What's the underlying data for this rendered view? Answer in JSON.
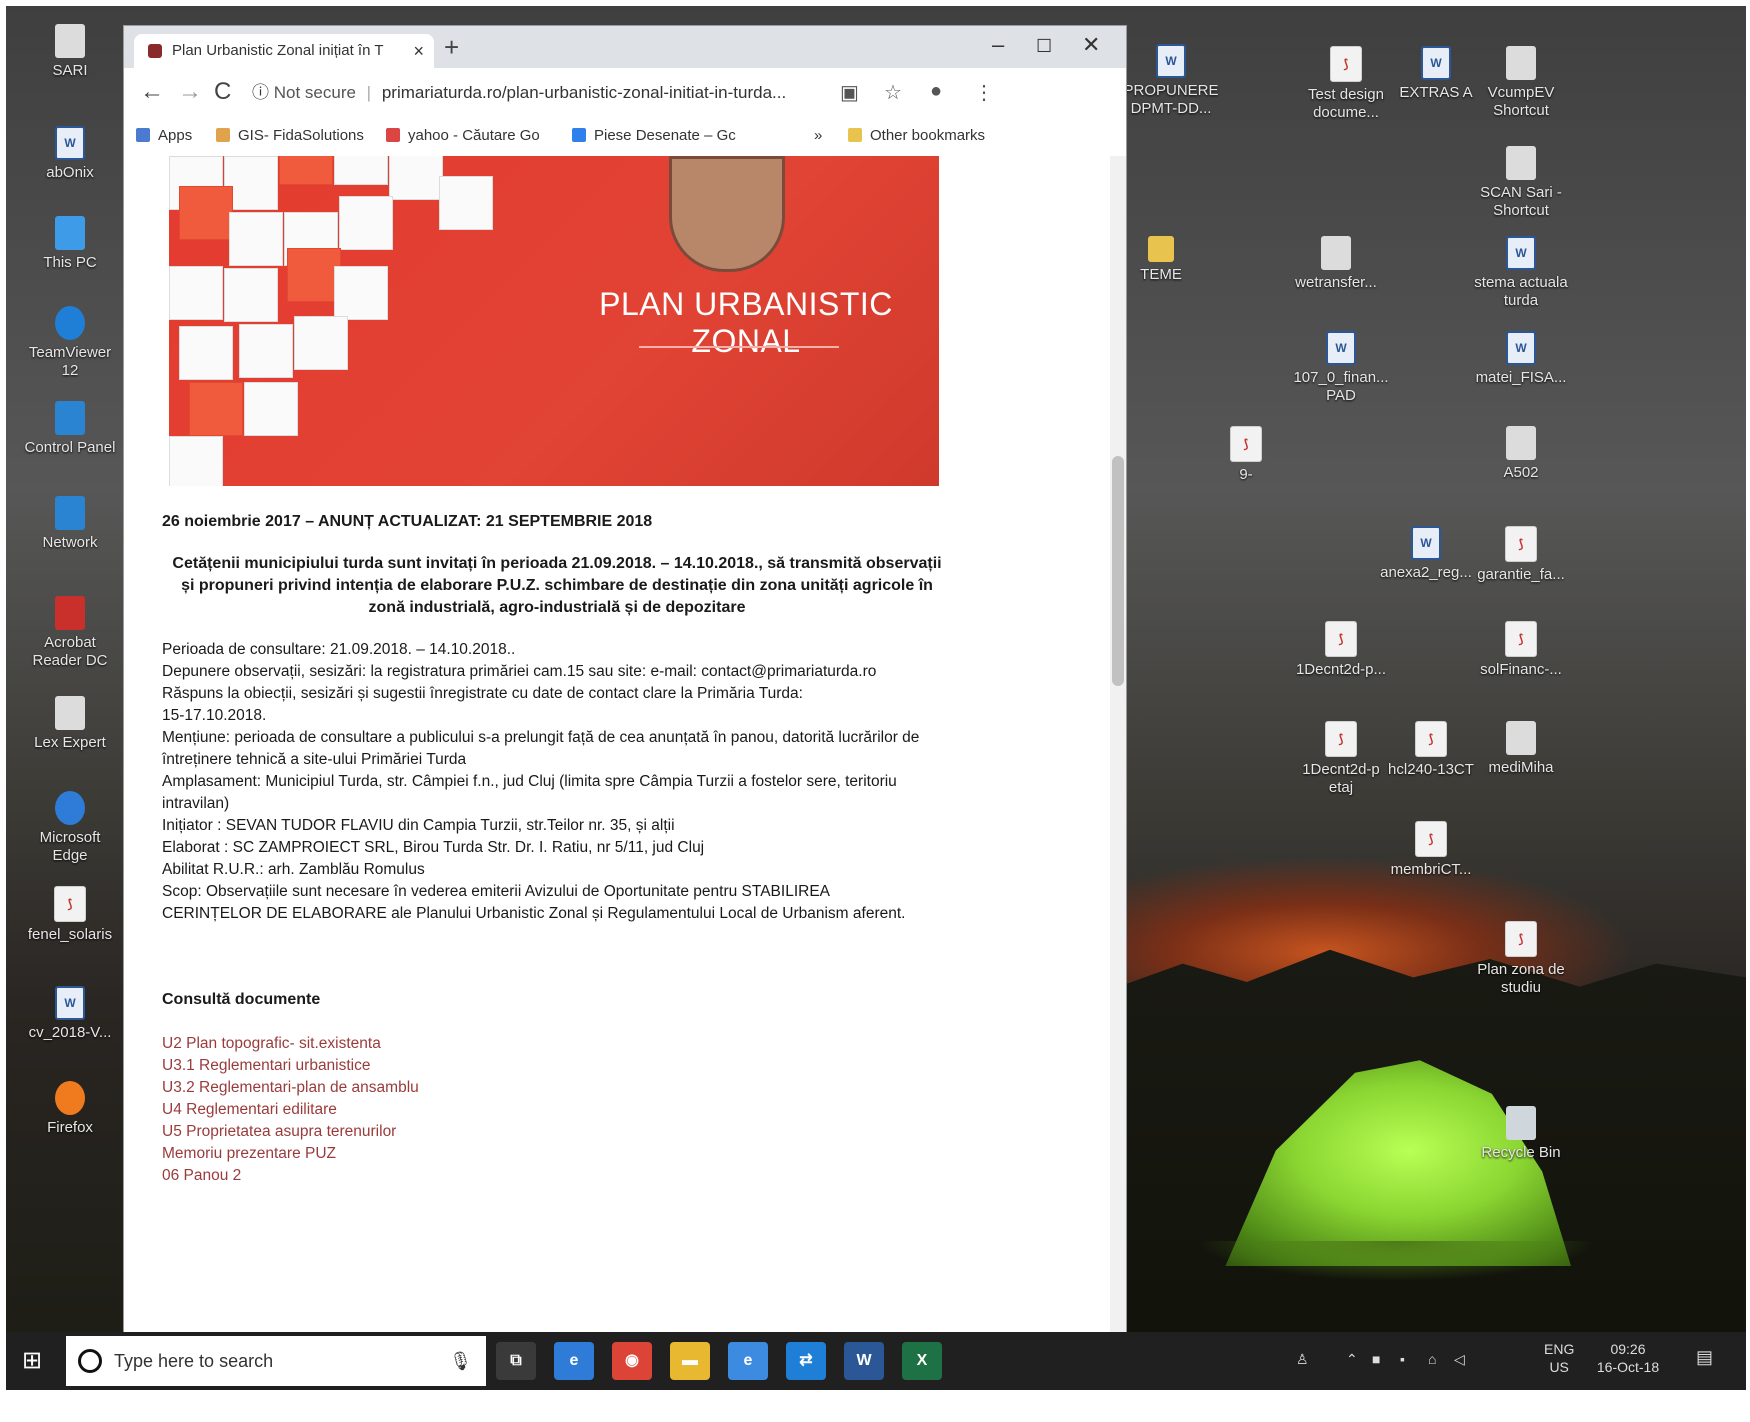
{
  "browser": {
    "tab_title": "Plan Urbanistic Zonal inițiat în T",
    "tab_close": "×",
    "new_tab": "+",
    "window_controls": {
      "minimize": "–",
      "maximize": "☐",
      "close": "✕"
    },
    "nav": {
      "back": "←",
      "forward": "→",
      "reload": "C"
    },
    "security_label": "Not secure",
    "url": "primariaturda.ro/plan-urbanistic-zonal-initiat-in-turda...",
    "bookmarks": [
      {
        "label": "Apps",
        "icon": "apps-grid-icon"
      },
      {
        "label": "GIS- FidaSolutions",
        "icon": "gis-icon"
      },
      {
        "label": "yahoo - Căutare Go",
        "icon": "google-icon"
      },
      {
        "label": "Piese Desenate – Gc",
        "icon": "drive-icon"
      }
    ],
    "bookmarks_more": "»",
    "other_bookmarks": "Other bookmarks"
  },
  "page": {
    "banner_title": "PLAN URBANISTIC ZONAL",
    "heading": "26 noiembrie 2017 – ANUNȚ ACTUALIZAT: 21 SEPTEMBRIE 2018",
    "intro_lines": [
      "Cetățenii municipiului turda sunt invitați în perioada 21.09.2018. – 14.10.2018., să transmită observații",
      "și propuneri privind intenția de elaborare P.U.Z. schimbare de destinație din zona unități agricole în",
      "zonă industrială, agro-industrială și de depozitare"
    ],
    "details": [
      "Perioada de consultare: 21.09.2018. – 14.10.2018..",
      "Depunere observații, sesizări: la registratura primăriei cam.15 sau site: e-mail: contact@primariaturda.ro",
      "Răspuns la obiecții, sesizări și sugestii înregistrate cu date de contact clare la Primăria Turda:",
      "15-17.10.2018.",
      "Mențiune: perioada de consultare a publicului s-a prelungit față de cea anunțată în panou, datorită lucrărilor de",
      "întreținere tehnică a site-ului Primăriei Turda",
      "Amplasament: Municipiul Turda, str. Câmpiei f.n., jud Cluj (limita spre Câmpia Turzii a fostelor sere, teritoriu",
      "intravilan)",
      "Inițiator : SEVAN TUDOR FLAVIU din Campia Turzii, str.Teilor nr. 35, și alții",
      "Elaborat : SC ZAMPROIECT SRL, Birou Turda Str. Dr. I. Ratiu, nr 5/11, jud Cluj",
      "Abilitat R.U.R.: arh. Zamblău Romulus",
      "Scop: Observațiile sunt necesare în vederea emiterii Avizului de Oportunitate pentru STABILIREA",
      "CERINȚELOR DE ELABORARE ale Planului Urbanistic Zonal și Regulamentului Local de Urbanism aferent."
    ],
    "docs_title": "Consultă documente",
    "docs": [
      "U2 Plan topografic- sit.existenta",
      "U3.1 Reglementari urbanistice",
      "U3.2 Reglementari-plan de ansamblu",
      "U4 Reglementari edilitare",
      "U5 Proprietatea asupra terenurilor",
      "Memoriu prezentare PUZ",
      "06 Panou 2"
    ]
  },
  "desktop_left": [
    {
      "label": "SARI",
      "icon": "user-folder-icon",
      "kind": "generic"
    },
    {
      "label": "abOnix",
      "icon": "word-doc-icon",
      "kind": "word"
    },
    {
      "label": "This PC",
      "icon": "this-pc-icon",
      "kind": "pc"
    },
    {
      "label": "TeamViewer 12",
      "icon": "teamviewer-icon",
      "kind": "blue"
    },
    {
      "label": "Control Panel",
      "icon": "control-panel-icon",
      "kind": "ctrl"
    },
    {
      "label": "Network",
      "icon": "network-icon",
      "kind": "ctrl"
    },
    {
      "label": "Acrobat Reader DC",
      "icon": "acrobat-icon",
      "kind": "red"
    },
    {
      "label": "Lex Expert",
      "icon": "lex-expert-icon",
      "kind": "generic"
    },
    {
      "label": "Microsoft Edge",
      "icon": "edge-icon",
      "kind": "edge"
    },
    {
      "label": "fenel_solaris",
      "icon": "pdf-file-icon",
      "kind": "pdf"
    },
    {
      "label": "cv_2018-V...",
      "icon": "word-doc-icon",
      "kind": "word"
    },
    {
      "label": "Firefox",
      "icon": "firefox-icon",
      "kind": "fox"
    }
  ],
  "desktop_right": [
    {
      "label": "PROPUNERE DPMT-DD...",
      "icon": "word-doc-icon",
      "kind": "word"
    },
    {
      "label": "Test design docume...",
      "icon": "pdf-file-icon",
      "kind": "pdf"
    },
    {
      "label": "EXTRAS A",
      "icon": "word-doc-icon",
      "kind": "word"
    },
    {
      "label": "VcumpEV Shortcut",
      "icon": "shortcut-icon",
      "kind": "generic"
    },
    {
      "label": "SCAN Sari - Shortcut",
      "icon": "shortcut-icon",
      "kind": "generic"
    },
    {
      "label": "TEME",
      "icon": "folder-icon",
      "kind": "folder"
    },
    {
      "label": "wetransfer...",
      "icon": "archive-icon",
      "kind": "generic"
    },
    {
      "label": "stema actuala turda",
      "icon": "word-doc-icon",
      "kind": "word"
    },
    {
      "label": "107_0_finan... PAD",
      "icon": "word-doc-icon",
      "kind": "word"
    },
    {
      "label": "matei_FISA...",
      "icon": "word-doc-icon",
      "kind": "word"
    },
    {
      "label": "9-",
      "icon": "pdf-file-icon",
      "kind": "pdf"
    },
    {
      "label": "A502",
      "icon": "generic-file-icon",
      "kind": "generic"
    },
    {
      "label": "anexa2_reg...",
      "icon": "word-doc-icon",
      "kind": "word"
    },
    {
      "label": "garantie_fa...",
      "icon": "pdf-file-icon",
      "kind": "pdf"
    },
    {
      "label": "1Decnt2d-p...",
      "icon": "pdf-file-icon",
      "kind": "pdf"
    },
    {
      "label": "solFinanc-...",
      "icon": "pdf-file-icon",
      "kind": "pdf"
    },
    {
      "label": "1Decnt2d-p etaj",
      "icon": "pdf-file-icon",
      "kind": "pdf"
    },
    {
      "label": "hcl240-13CT",
      "icon": "pdf-file-icon",
      "kind": "pdf"
    },
    {
      "label": "mediMiha",
      "icon": "generic-file-icon",
      "kind": "generic"
    },
    {
      "label": "membriCT...",
      "icon": "pdf-file-icon",
      "kind": "pdf"
    },
    {
      "label": "Plan zona de studiu",
      "icon": "pdf-file-icon",
      "kind": "pdf"
    },
    {
      "label": "Recycle Bin",
      "icon": "recycle-bin-icon",
      "kind": "bin"
    }
  ],
  "taskbar": {
    "search_placeholder": "Type here to search",
    "apps": [
      {
        "name": "task-view-icon",
        "glyph": "⧉",
        "color": "#3a3a3a"
      },
      {
        "name": "edge-icon",
        "glyph": "e",
        "color": "#2f7bd8"
      },
      {
        "name": "chrome-icon",
        "glyph": "◉",
        "color": "#db4437"
      },
      {
        "name": "file-explorer-icon",
        "glyph": "▬",
        "color": "#e8b830"
      },
      {
        "name": "ie-icon",
        "glyph": "e",
        "color": "#3c8be0"
      },
      {
        "name": "teamviewer-icon",
        "glyph": "⇄",
        "color": "#1f7fd6"
      },
      {
        "name": "word-icon",
        "glyph": "W",
        "color": "#2b5797"
      },
      {
        "name": "excel-icon",
        "glyph": "X",
        "color": "#1e7145"
      }
    ],
    "lang_top": "ENG",
    "lang_bottom": "US",
    "time": "09:26",
    "date": "16-Oct-18"
  }
}
